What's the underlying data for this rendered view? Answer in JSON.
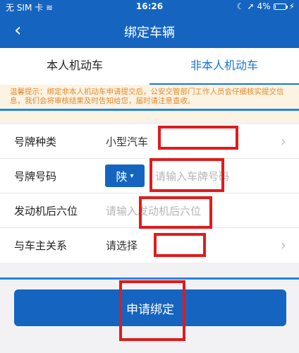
{
  "status": {
    "carrier": "无 SIM 卡",
    "time": "16:26",
    "battery": "4%",
    "battery_level": 0.04
  },
  "nav": {
    "back_icon": "‹",
    "title": "绑定车辆"
  },
  "tabs": [
    {
      "label": "本人机动车",
      "active": false
    },
    {
      "label": "非本人机动车",
      "active": true
    }
  ],
  "notice": {
    "text": "温馨提示：绑定非本人机动车申请提交后，公安交管部门工作人员会仔细核实提交信息，我们会将审核结果及时告知给您，届时请注意查收。"
  },
  "form": {
    "plate_type": {
      "label": "号牌种类",
      "value": "小型汽车"
    },
    "plate_number": {
      "label": "号牌号码",
      "province": "陕",
      "placeholder": "请输入车牌号码"
    },
    "engine": {
      "label": "发动机后六位",
      "placeholder": "请输入发动机后六位"
    },
    "relation": {
      "label": "与车主关系",
      "value": "请选择"
    }
  },
  "submit": {
    "label": "申请绑定"
  },
  "colors": {
    "primary": "#1565c0",
    "annotation": "#e01b1b",
    "notice_text": "#e08a2c"
  }
}
